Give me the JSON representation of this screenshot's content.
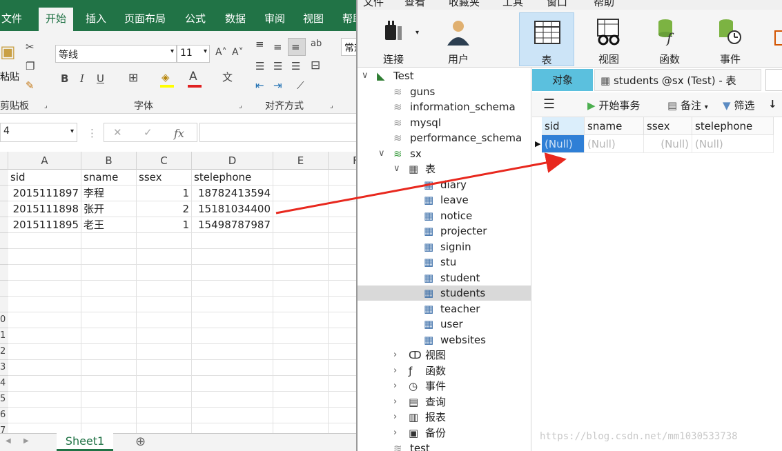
{
  "excel": {
    "ribbon_tabs": [
      "文件",
      "开始",
      "插入",
      "页面布局",
      "公式",
      "数据",
      "审阅",
      "视图",
      "帮助"
    ],
    "active_tab": "开始",
    "font_name": "等线",
    "font_size": "11",
    "paste_label": "粘贴",
    "groups": {
      "clipboard": "剪贴板",
      "font": "字体",
      "align": "对齐方式",
      "number_format": "常规"
    },
    "name_box": "4",
    "fx": "fx",
    "columns": [
      "A",
      "B",
      "C",
      "D",
      "E",
      "F"
    ],
    "row_numbers": [
      "",
      "",
      "",
      "",
      "",
      "",
      "",
      "",
      "",
      "0",
      "1",
      "2",
      "3",
      "4",
      "5",
      "6",
      "7"
    ],
    "table": {
      "header": [
        "sid",
        "sname",
        "ssex",
        "stelephone"
      ],
      "rows": [
        [
          "2015111897",
          "李程",
          "1",
          "18782413594"
        ],
        [
          "2015111898",
          "张开",
          "2",
          "15181034400"
        ],
        [
          "2015111895",
          "老王",
          "1",
          "15498787987"
        ]
      ]
    },
    "sheet_tab": "Sheet1"
  },
  "navicat": {
    "menu": [
      "文件",
      "查看",
      "收藏夹",
      "工具",
      "窗口",
      "帮助"
    ],
    "toolbar": [
      "连接",
      "用户",
      "表",
      "视图",
      "函数",
      "事件"
    ],
    "active_toolbar": "表",
    "tree": {
      "connection": "Test",
      "databases": [
        "guns",
        "information_schema",
        "mysql",
        "performance_schema"
      ],
      "open_db": "sx",
      "tables_label": "表",
      "tables": [
        "diary",
        "leave",
        "notice",
        "projecter",
        "signin",
        "stu",
        "student",
        "students",
        "teacher",
        "user",
        "websites"
      ],
      "selected_table": "students",
      "other_groups": [
        "视图",
        "函数",
        "事件",
        "查询",
        "报表",
        "备份"
      ],
      "next_db": "test"
    },
    "tabs": {
      "objects": "对象",
      "table_tab": "students @sx (Test) - 表"
    },
    "subtoolbar": {
      "begin_tx": "开始事务",
      "note": "备注",
      "filter": "筛选"
    },
    "grid": {
      "columns": [
        "sid",
        "sname",
        "ssex",
        "stelephone"
      ],
      "row": [
        "(Null)",
        "(Null)",
        "(Null)",
        "(Null)"
      ]
    }
  },
  "watermark": "https://blog.csdn.net/mm1030533738",
  "colors": {
    "excel_green": "#217346",
    "active_blue": "#cce4f7",
    "tab_cyan": "#5bc0de",
    "arrow_red": "#e8281e"
  }
}
